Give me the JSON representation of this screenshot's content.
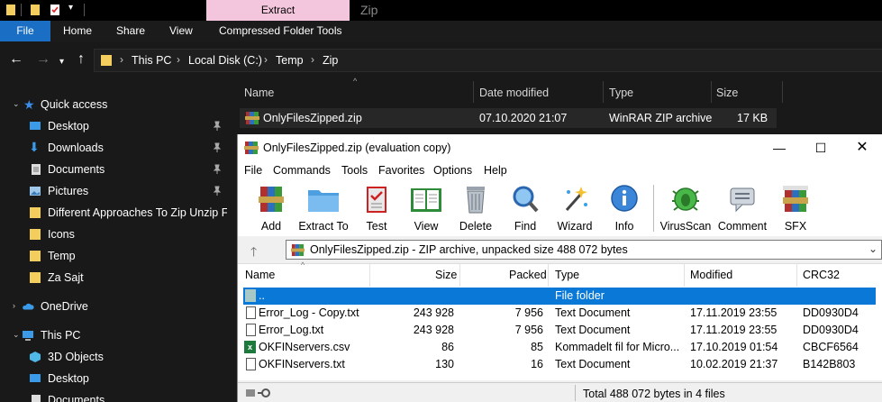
{
  "explorer": {
    "context_tab": "Extract",
    "window_title": "Zip",
    "ribbon_tabs": [
      "File",
      "Home",
      "Share",
      "View",
      "Compressed Folder Tools"
    ],
    "breadcrumb": [
      "This PC",
      "Local Disk (C:)",
      "Temp",
      "Zip"
    ],
    "sidebar": [
      {
        "label": "Quick access",
        "icon": "star-icon"
      },
      {
        "label": "Desktop",
        "icon": "desktop-icon",
        "pinned": true
      },
      {
        "label": "Downloads",
        "icon": "download-icon",
        "pinned": true
      },
      {
        "label": "Documents",
        "icon": "documents-icon",
        "pinned": true
      },
      {
        "label": "Pictures",
        "icon": "pictures-icon",
        "pinned": true
      },
      {
        "label": "Different Approaches To Zip Unzip Files",
        "icon": "folder-icon"
      },
      {
        "label": "Icons",
        "icon": "folder-icon"
      },
      {
        "label": "Temp",
        "icon": "folder-icon"
      },
      {
        "label": "Za Sajt",
        "icon": "folder-icon"
      },
      {
        "label": "OneDrive",
        "icon": "cloud-icon"
      },
      {
        "label": "This PC",
        "icon": "computer-icon"
      },
      {
        "label": "3D Objects",
        "icon": "cube-icon"
      },
      {
        "label": "Desktop",
        "icon": "desktop-icon"
      },
      {
        "label": "Documents",
        "icon": "documents-icon"
      }
    ],
    "columns": [
      "Name",
      "Date modified",
      "Type",
      "Size"
    ],
    "files": [
      {
        "name": "OnlyFilesZipped.zip",
        "date": "07.10.2020 21:07",
        "type": "WinRAR ZIP archive",
        "size": "17 KB"
      }
    ]
  },
  "winrar": {
    "title": "OnlyFilesZipped.zip (evaluation copy)",
    "menu": [
      "File",
      "Commands",
      "Tools",
      "Favorites",
      "Options",
      "Help"
    ],
    "toolbar": [
      "Add",
      "Extract To",
      "Test",
      "View",
      "Delete",
      "Find",
      "Wizard",
      "Info",
      "VirusScan",
      "Comment",
      "SFX"
    ],
    "path": "OnlyFilesZipped.zip - ZIP archive, unpacked size 488 072 bytes",
    "columns": [
      "Name",
      "Size",
      "Packed",
      "Type",
      "Modified",
      "CRC32"
    ],
    "rows": [
      {
        "name": "..",
        "size": "",
        "packed": "",
        "type": "File folder",
        "modified": "",
        "crc": ""
      },
      {
        "name": "Error_Log - Copy.txt",
        "size": "243 928",
        "packed": "7 956",
        "type": "Text Document",
        "modified": "17.11.2019 23:55",
        "crc": "DD0930D4"
      },
      {
        "name": "Error_Log.txt",
        "size": "243 928",
        "packed": "7 956",
        "type": "Text Document",
        "modified": "17.11.2019 23:55",
        "crc": "DD0930D4"
      },
      {
        "name": "OKFINservers.csv",
        "size": "86",
        "packed": "85",
        "type": "Kommadelt fil for Micro...",
        "modified": "17.10.2019 01:54",
        "crc": "CBCF6564"
      },
      {
        "name": "OKFINservers.txt",
        "size": "130",
        "packed": "16",
        "type": "Text Document",
        "modified": "10.02.2019 21:37",
        "crc": "B142B803"
      }
    ],
    "status": "Total 488 072 bytes in 4 files"
  }
}
